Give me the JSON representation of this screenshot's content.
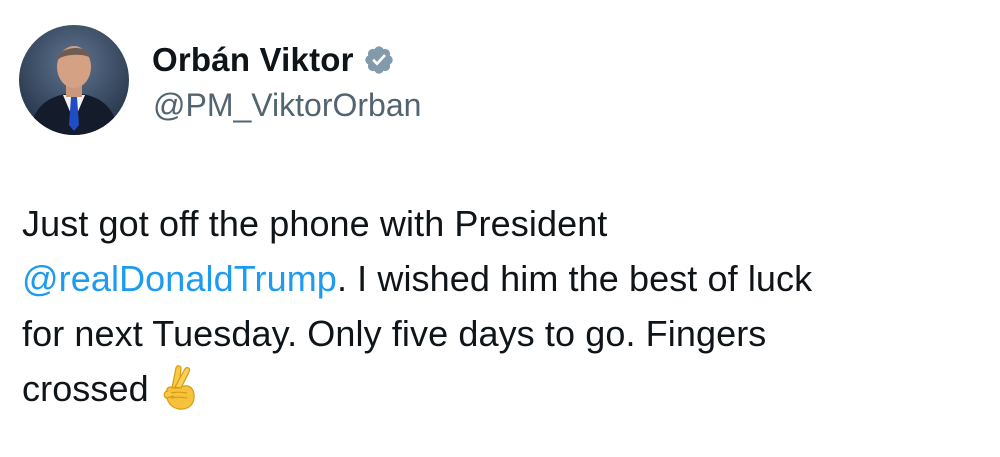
{
  "author": {
    "display_name": "Orbán Viktor",
    "handle": "@PM_ViktorOrban",
    "avatar_icon": "profile-photo",
    "verified_icon": "verified-badge-icon"
  },
  "tweet": {
    "line1": "Just got off the phone with President",
    "mention": "@realDonaldTrump",
    "line2_rest": ". I wished him the best of luck",
    "line3": "for next Tuesday. Only five days to go. Fingers",
    "line4": "crossed",
    "emoji_icon": "crossed-fingers-icon"
  },
  "colors": {
    "text": "#0f1419",
    "secondary": "#536471",
    "link": "#1d9bf0",
    "badge": "#829aab"
  }
}
